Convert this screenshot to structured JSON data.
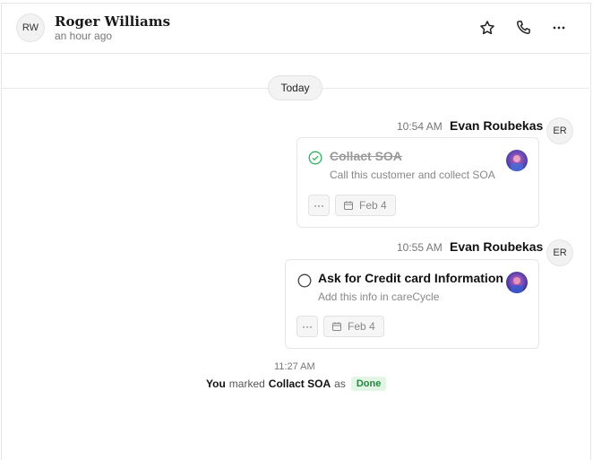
{
  "header": {
    "avatar_initials": "RW",
    "name": "Roger Williams",
    "last_seen": "an hour ago"
  },
  "divider": {
    "label": "Today"
  },
  "messages": [
    {
      "time": "10:54 AM",
      "sender": "Evan Roubekas",
      "avatar_initials": "ER",
      "task": {
        "title": "Collact SOA",
        "subtitle": "Call this customer and collect SOA",
        "completed": true,
        "more_label": "···",
        "date": "Feb 4"
      }
    },
    {
      "time": "10:55 AM",
      "sender": "Evan Roubekas",
      "avatar_initials": "ER",
      "task": {
        "title": "Ask for Credit card Information",
        "subtitle": "Add this info in careCycle",
        "completed": false,
        "more_label": "···",
        "date": "Feb 4"
      }
    }
  ],
  "activity": {
    "time": "11:27 AM",
    "actor": "You",
    "verb": "marked",
    "task": "Collact SOA",
    "preposition": "as",
    "status": "Done",
    "status_color": "#1f8a3b",
    "status_bg": "#e3f6e6"
  },
  "icons": {
    "star": "star-icon",
    "phone": "phone-icon",
    "more": "more-horizontal-icon",
    "check": "check-circle-icon",
    "circle": "empty-circle-icon",
    "calendar": "calendar-icon"
  },
  "colors": {
    "check_green": "#2fb25a"
  }
}
